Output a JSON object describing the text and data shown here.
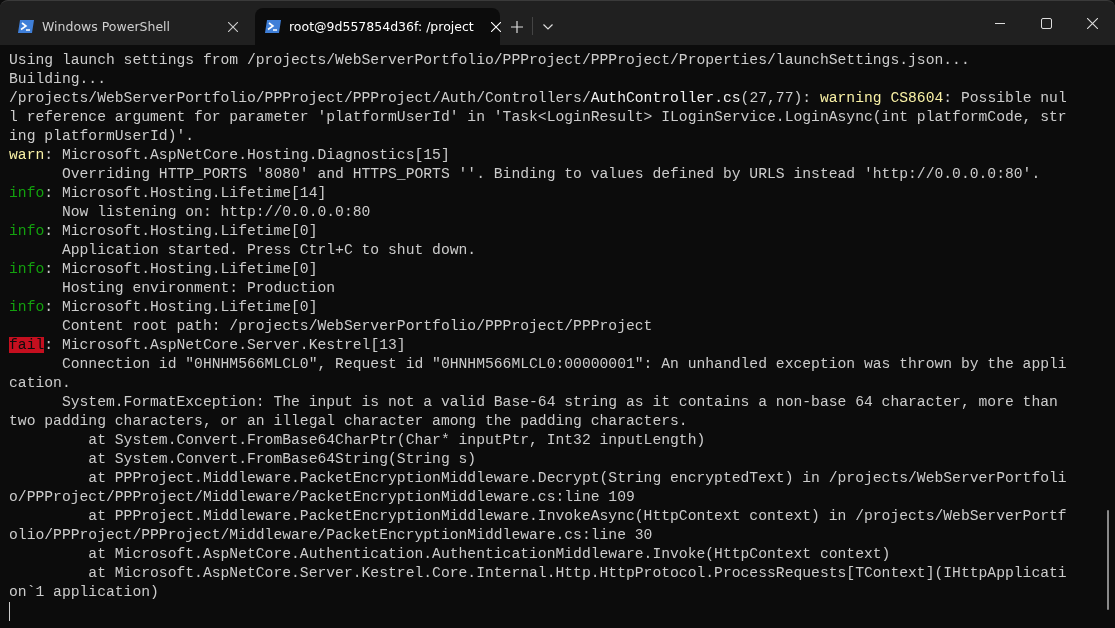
{
  "tabs": [
    {
      "title": "Windows PowerShell",
      "selected": false
    },
    {
      "title": "root@9d557854d36f: /project",
      "selected": true
    }
  ],
  "terminal": {
    "lines": [
      [
        {
          "text": "Using launch settings from /projects/WebServerPortfolio/PPProject/PPProject/Properties/launchSettings.json...",
          "kind": "normal"
        }
      ],
      [
        {
          "text": "Building...",
          "kind": "normal"
        }
      ],
      [
        {
          "text": "/projects/WebServerPortfolio/PPProject/PPProject/Auth/Controllers/",
          "kind": "normal"
        },
        {
          "text": "AuthController.cs",
          "kind": "bright"
        },
        {
          "text": "(27,77): ",
          "kind": "normal"
        },
        {
          "text": "warning CS8604",
          "kind": "warning"
        },
        {
          "text": ": Possible nul",
          "kind": "normal"
        }
      ],
      [
        {
          "text": "l reference argument for parameter 'platformUserId' in 'Task<LoginResult> ILoginService.LoginAsync(int platformCode, str",
          "kind": "normal"
        }
      ],
      [
        {
          "text": "ing platformUserId)'.",
          "kind": "normal"
        }
      ],
      [
        {
          "text": "warn",
          "kind": "warning"
        },
        {
          "text": ": Microsoft.AspNetCore.Hosting.Diagnostics[15]",
          "kind": "normal"
        }
      ],
      [
        {
          "text": "      Overriding HTTP_PORTS '8080' and HTTPS_PORTS ''. Binding to values defined by URLS instead 'http://0.0.0.0:80'.",
          "kind": "normal"
        }
      ],
      [
        {
          "text": "info",
          "kind": "info"
        },
        {
          "text": ": Microsoft.Hosting.Lifetime[14]",
          "kind": "normal"
        }
      ],
      [
        {
          "text": "      Now listening on: http://0.0.0.0:80",
          "kind": "normal"
        }
      ],
      [
        {
          "text": "info",
          "kind": "info"
        },
        {
          "text": ": Microsoft.Hosting.Lifetime[0]",
          "kind": "normal"
        }
      ],
      [
        {
          "text": "      Application started. Press Ctrl+C to shut down.",
          "kind": "normal"
        }
      ],
      [
        {
          "text": "info",
          "kind": "info"
        },
        {
          "text": ": Microsoft.Hosting.Lifetime[0]",
          "kind": "normal"
        }
      ],
      [
        {
          "text": "      Hosting environment: Production",
          "kind": "normal"
        }
      ],
      [
        {
          "text": "info",
          "kind": "info"
        },
        {
          "text": ": Microsoft.Hosting.Lifetime[0]",
          "kind": "normal"
        }
      ],
      [
        {
          "text": "      Content root path: /projects/WebServerPortfolio/PPProject/PPProject",
          "kind": "normal"
        }
      ],
      [
        {
          "text": "fail",
          "kind": "fail"
        },
        {
          "text": ": Microsoft.AspNetCore.Server.Kestrel[13]",
          "kind": "normal"
        }
      ],
      [
        {
          "text": "      Connection id \"0HNHM566MLCL0\", Request id \"0HNHM566MLCL0:00000001\": An unhandled exception was thrown by the appli",
          "kind": "normal"
        }
      ],
      [
        {
          "text": "cation.",
          "kind": "normal"
        }
      ],
      [
        {
          "text": "      System.FormatException: The input is not a valid Base-64 string as it contains a non-base 64 character, more than",
          "kind": "normal"
        }
      ],
      [
        {
          "text": "two padding characters, or an illegal character among the padding characters.",
          "kind": "normal"
        }
      ],
      [
        {
          "text": "         at System.Convert.FromBase64CharPtr(Char* inputPtr, Int32 inputLength)",
          "kind": "normal"
        }
      ],
      [
        {
          "text": "         at System.Convert.FromBase64String(String s)",
          "kind": "normal"
        }
      ],
      [
        {
          "text": "         at PPProject.Middleware.PacketEncryptionMiddleware.Decrypt(String encryptedText) in /projects/WebServerPortfoli",
          "kind": "normal"
        }
      ],
      [
        {
          "text": "o/PPProject/PPProject/Middleware/PacketEncryptionMiddleware.cs:line 109",
          "kind": "normal"
        }
      ],
      [
        {
          "text": "         at PPProject.Middleware.PacketEncryptionMiddleware.InvokeAsync(HttpContext context) in /projects/WebServerPortf",
          "kind": "normal"
        }
      ],
      [
        {
          "text": "olio/PPProject/PPProject/Middleware/PacketEncryptionMiddleware.cs:line 30",
          "kind": "normal"
        }
      ],
      [
        {
          "text": "         at Microsoft.AspNetCore.Authentication.AuthenticationMiddleware.Invoke(HttpContext context)",
          "kind": "normal"
        }
      ],
      [
        {
          "text": "         at Microsoft.AspNetCore.Server.Kestrel.Core.Internal.Http.HttpProtocol.ProcessRequests[TContext](IHttpApplicati",
          "kind": "normal"
        }
      ],
      [
        {
          "text": "on`1 application)",
          "kind": "normal"
        }
      ]
    ]
  }
}
